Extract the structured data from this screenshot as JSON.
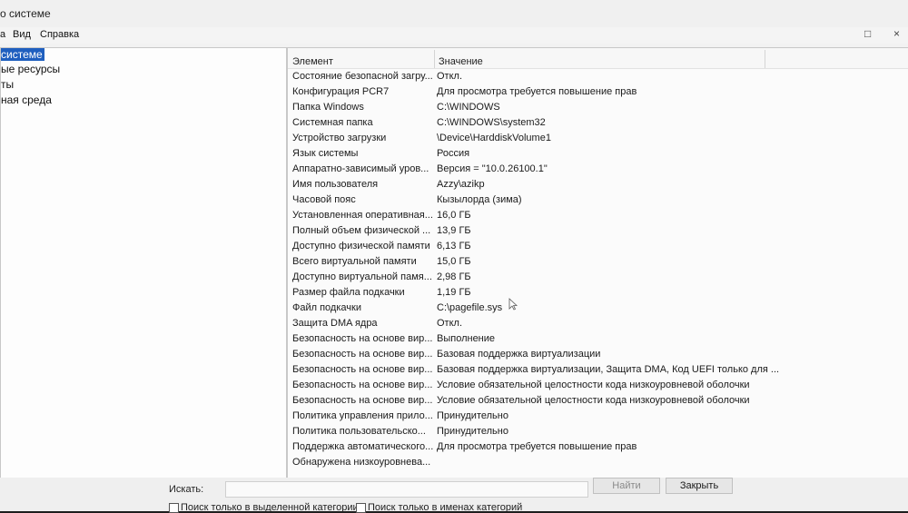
{
  "window": {
    "title": "о системе",
    "close_glyph": "×",
    "restore_glyph": "□"
  },
  "menu": {
    "items": [
      "а",
      "Вид",
      "Справка"
    ]
  },
  "tree": {
    "items": [
      {
        "label": "системе",
        "selected": true
      },
      {
        "label": "ые ресурсы",
        "selected": false
      },
      {
        "label": "ты",
        "selected": false
      },
      {
        "label": "ная среда",
        "selected": false
      }
    ]
  },
  "list": {
    "columns": [
      "Элемент",
      "Значение"
    ],
    "rows": [
      [
        "Состояние безопасной загру...",
        "Откл."
      ],
      [
        "Конфигурация PCR7",
        "Для просмотра требуется повышение прав"
      ],
      [
        "Папка Windows",
        "C:\\WINDOWS"
      ],
      [
        "Системная папка",
        "C:\\WINDOWS\\system32"
      ],
      [
        "Устройство загрузки",
        "\\Device\\HarddiskVolume1"
      ],
      [
        "Язык системы",
        "Россия"
      ],
      [
        "Аппаратно-зависимый уров...",
        "Версия = \"10.0.26100.1\""
      ],
      [
        "Имя пользователя",
        "Azzy\\azikp"
      ],
      [
        "Часовой пояс",
        "Кызылорда (зима)"
      ],
      [
        "Установленная оперативная...",
        "16,0 ГБ"
      ],
      [
        "Полный объем физической ...",
        "13,9 ГБ"
      ],
      [
        "Доступно физической памяти",
        "6,13 ГБ"
      ],
      [
        "Всего виртуальной памяти",
        "15,0 ГБ"
      ],
      [
        "Доступно виртуальной памя...",
        "2,98 ГБ"
      ],
      [
        "Размер файла подкачки",
        "1,19 ГБ"
      ],
      [
        "Файл подкачки",
        "C:\\pagefile.sys"
      ],
      [
        "Защита DMA ядра",
        "Откл."
      ],
      [
        "Безопасность на основе вир...",
        "Выполнение"
      ],
      [
        "Безопасность на основе вир...",
        "Базовая поддержка виртуализации"
      ],
      [
        "Безопасность на основе вир...",
        "Базовая поддержка виртуализации, Защита DMA, Код UEFI только для ..."
      ],
      [
        "Безопасность на основе вир...",
        "Условие обязательной целостности кода низкоуровневой оболочки"
      ],
      [
        "Безопасность на основе вир...",
        "Условие обязательной целостности кода низкоуровневой оболочки"
      ],
      [
        "Политика управления прило...",
        "Принудительно"
      ],
      [
        "Политика пользовательско...",
        "Принудительно"
      ],
      [
        "Поддержка автоматического...",
        "Для просмотра требуется повышение прав"
      ],
      [
        "Обнаружена низкоуровнева...",
        ""
      ]
    ]
  },
  "search": {
    "label": "Искать:",
    "value": "",
    "find_button": "Найти",
    "close_button": "Закрыть",
    "checkbox_selected_category": "Поиск только в выделенной категории",
    "checkbox_category_names": "Поиск только в именах категорий"
  },
  "colors": {
    "selection": "#1f5fbf",
    "window_bg": "#f2f2f2",
    "frame_bg": "#1e1e1e"
  }
}
